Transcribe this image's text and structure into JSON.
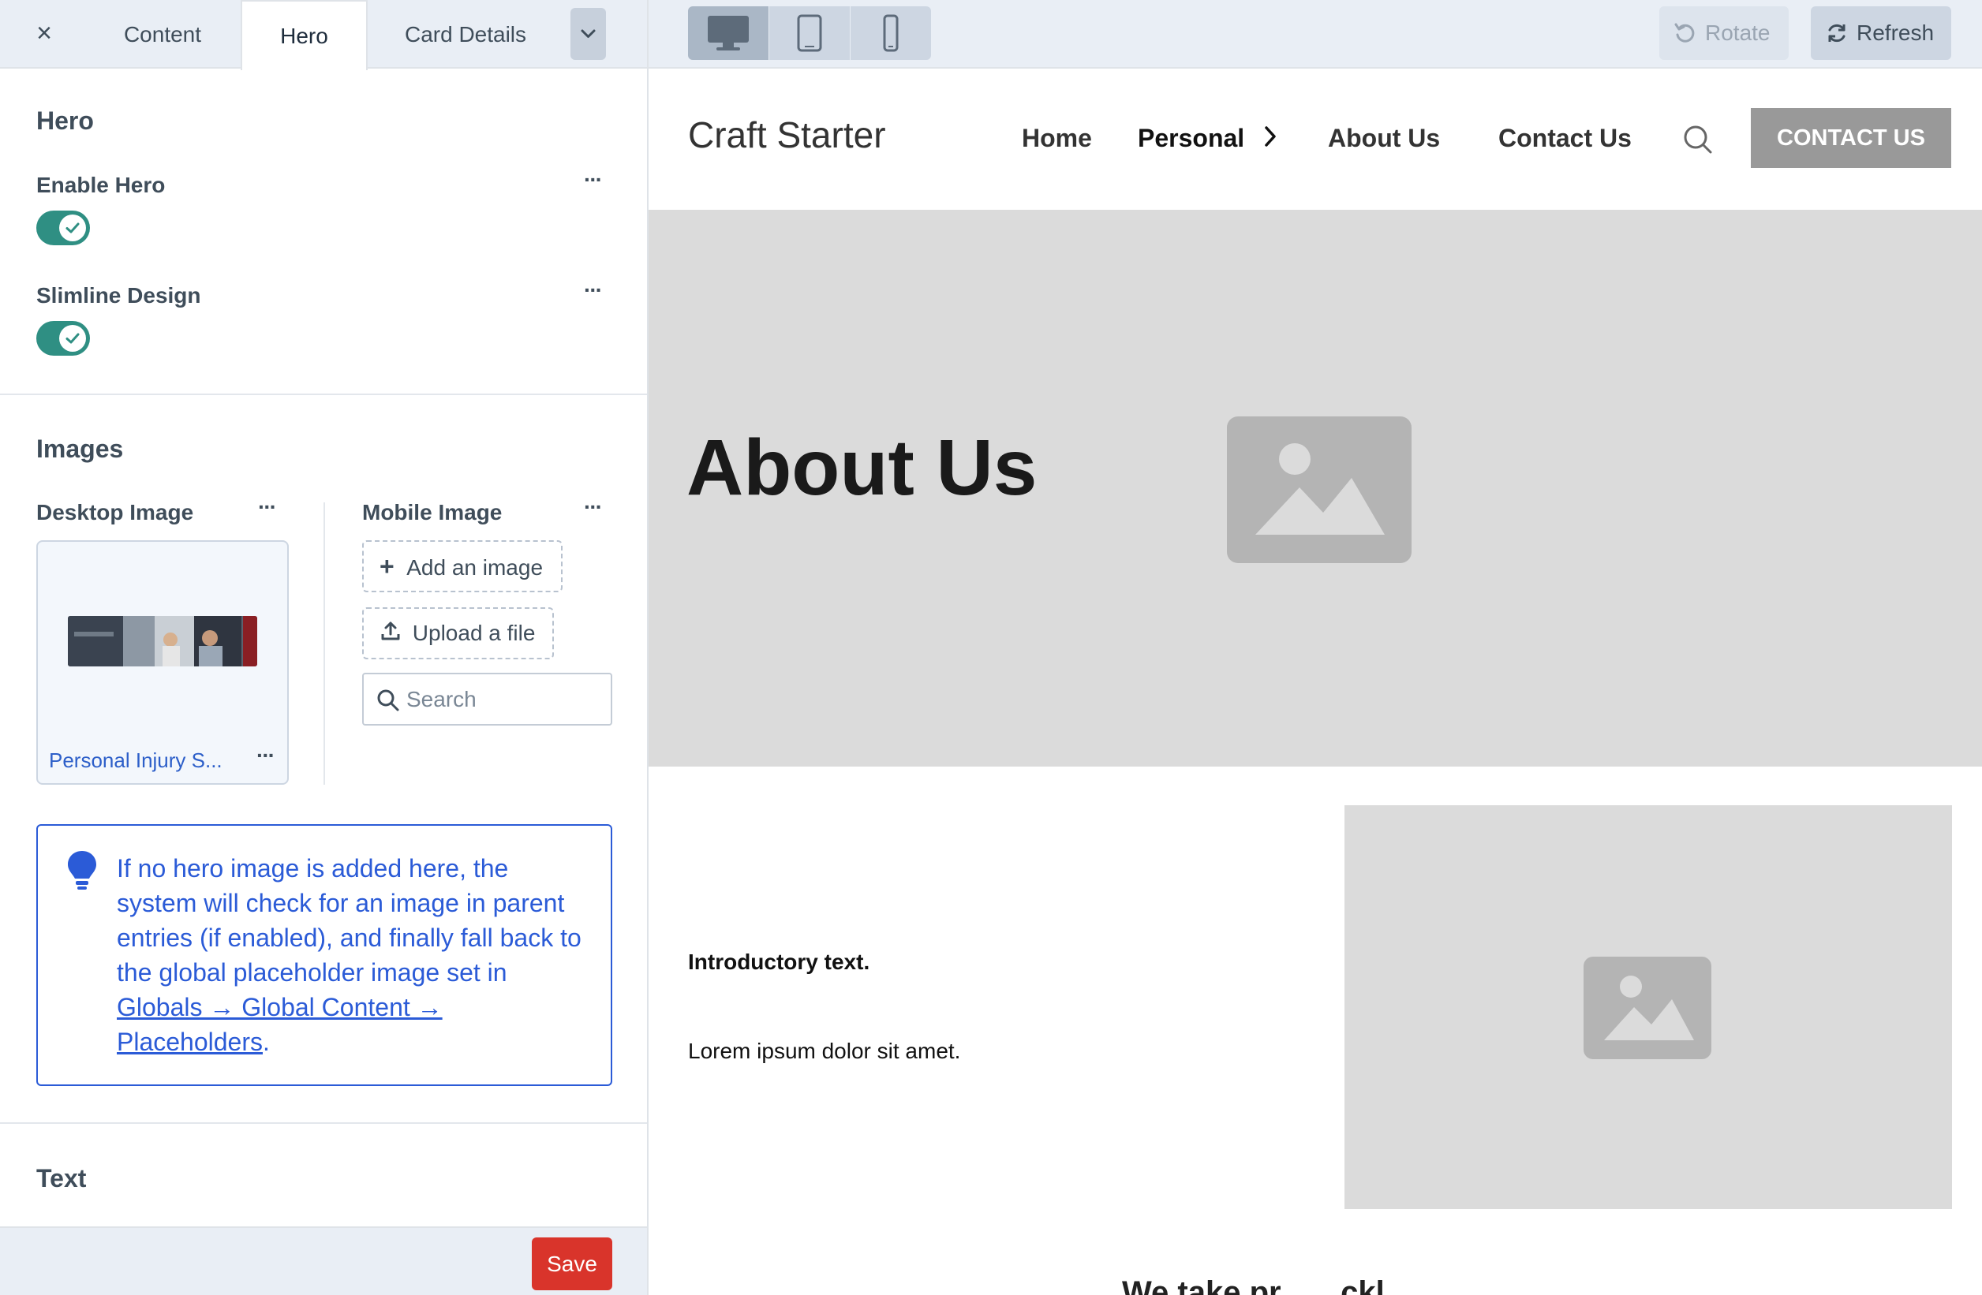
{
  "tabs": {
    "close": "×",
    "items": [
      "Content",
      "Hero",
      "Card Details"
    ],
    "active": "Hero"
  },
  "hero_section": {
    "title": "Hero",
    "enable_hero_label": "Enable Hero",
    "enable_hero_on": true,
    "slimline_label": "Slimline Design",
    "slimline_on": true
  },
  "images_section": {
    "title": "Images",
    "desktop_label": "Desktop Image",
    "desktop_asset_name": "Personal Injury S...",
    "mobile_label": "Mobile Image",
    "add_image": "Add an image",
    "upload_file": "Upload a file",
    "search_placeholder": "Search"
  },
  "tip": {
    "text_before": "If no hero image is added here, the system will check for an image in parent entries (if enabled), and finally fall back to the global placeholder image set in ",
    "link": "Globals → Global Content → Placeholders",
    "text_after": "."
  },
  "text_section": {
    "title": "Text"
  },
  "footer": {
    "save": "Save"
  },
  "preview_toolbar": {
    "rotate": "Rotate",
    "refresh": "Refresh"
  },
  "site": {
    "logo": "Craft Starter",
    "nav": [
      "Home",
      "Personal",
      "About Us",
      "Contact Us"
    ],
    "cta": "CONTACT US",
    "hero_title": "About Us",
    "intro": "Introductory text.",
    "body": "Lorem ipsum dolor sit amet.",
    "cut_heading": "We take pr... ...ckl..."
  },
  "colors": {
    "toggle_on": "#2f8f83",
    "link_blue": "#2b5bd7",
    "save_red": "#d9342b",
    "placeholder_gray": "#dbdbdb"
  }
}
